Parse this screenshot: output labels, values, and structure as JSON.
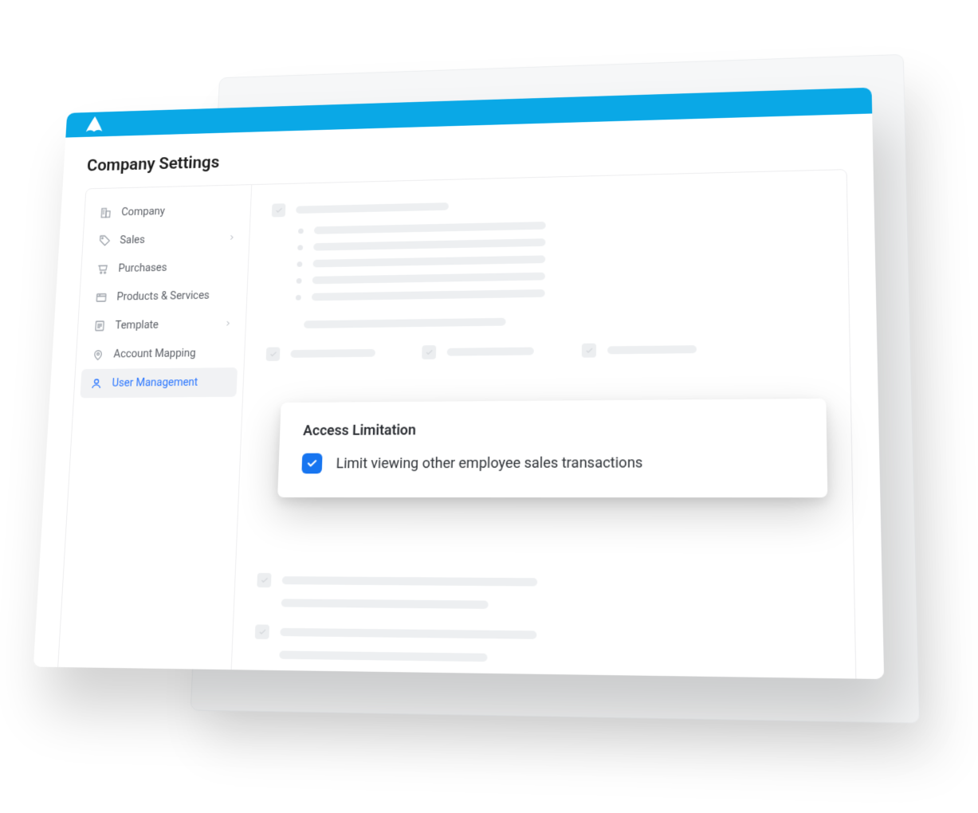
{
  "page_title": "Company Settings",
  "sidebar": {
    "items": [
      {
        "label": "Company",
        "icon": "building-icon",
        "expandable": false,
        "active": false
      },
      {
        "label": "Sales",
        "icon": "tag-icon",
        "expandable": true,
        "active": false
      },
      {
        "label": "Purchases",
        "icon": "cart-icon",
        "expandable": false,
        "active": false
      },
      {
        "label": "Products & Services",
        "icon": "box-icon",
        "expandable": false,
        "active": false
      },
      {
        "label": "Template",
        "icon": "document-icon",
        "expandable": true,
        "active": false
      },
      {
        "label": "Account Mapping",
        "icon": "pin-icon",
        "expandable": false,
        "active": false
      },
      {
        "label": "User Management",
        "icon": "user-icon",
        "expandable": false,
        "active": true
      }
    ]
  },
  "popup": {
    "title": "Access Limitation",
    "option_label": "Limit viewing other employee sales transactions",
    "checked": true
  },
  "colors": {
    "header": "#0aa8e6",
    "accent": "#1775f0",
    "sidebar_active_text": "#2a76ff"
  }
}
